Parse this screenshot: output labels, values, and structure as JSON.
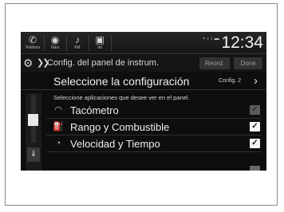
{
  "statusbar": {
    "buttons": [
      {
        "glyph": "✆",
        "caption": "Teléfono",
        "icon": "phone-icon"
      },
      {
        "glyph": "◉",
        "caption": "Navi",
        "icon": "navigation-icon"
      },
      {
        "glyph": "♪",
        "caption": "FM",
        "icon": "fm-radio-icon"
      },
      {
        "glyph": "▣",
        "caption": "Inf",
        "icon": "info-icon"
      }
    ],
    "signal": "≈ ı ı ▬",
    "clock": "12:34"
  },
  "titlebar": {
    "breadcrumb": "Config. del panel de instrum.",
    "reorder_label": "Reord.",
    "done_label": "Done"
  },
  "select": {
    "title": "Seleccione la configuración",
    "value": "Config. 2"
  },
  "instruction": "Seleccione aplicaciones que desee ver en el panel.",
  "items": [
    {
      "label": "Tacómetro",
      "checked": true,
      "enabled": false,
      "icon": "tachometer-icon"
    },
    {
      "label": "Rango y Combustible",
      "checked": true,
      "enabled": true,
      "icon": "fuel-pump-icon"
    },
    {
      "label": "Velocidad y Tiempo",
      "checked": true,
      "enabled": true,
      "icon": "speed-time-icon"
    }
  ],
  "colors": {
    "screen_bg": "#0e0e0e",
    "text": "#eeeeee",
    "checkbox_on": "#f4f4f4",
    "checkbox_disabled": "#5b5b5b"
  }
}
